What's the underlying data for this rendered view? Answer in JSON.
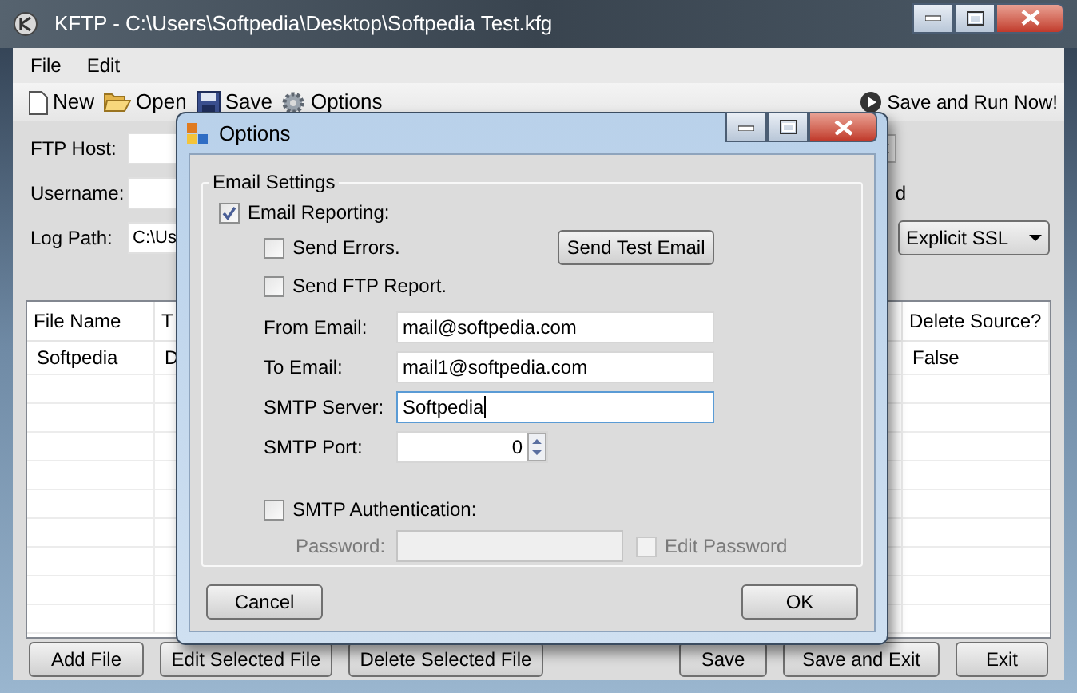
{
  "window": {
    "title": "KFTP - C:\\Users\\Softpedia\\Desktop\\Softpedia Test.kfg"
  },
  "menu": [
    {
      "label": "File"
    },
    {
      "label": "Edit"
    }
  ],
  "toolbar": {
    "items": [
      {
        "label": "New",
        "kind": "new"
      },
      {
        "label": "Open",
        "kind": "open"
      },
      {
        "label": "Save",
        "kind": "save"
      },
      {
        "label": "Options",
        "kind": "options"
      }
    ],
    "run_button": "Save and Run Now!"
  },
  "form": {
    "fields": [
      {
        "label": "FTP Host:"
      },
      {
        "label": "Username:"
      },
      {
        "label": "Log Path:",
        "value": "C:\\Us"
      }
    ],
    "partial_label": "d",
    "encryption": "Explicit SSL"
  },
  "table": {
    "columns": [
      "File Name",
      "T",
      "Delete Source?"
    ],
    "rows": [
      [
        "Softpedia",
        "D",
        "False"
      ]
    ]
  },
  "buttons_left": [
    "Add File",
    "Edit Selected File",
    "Delete Selected File"
  ],
  "buttons_right": [
    "Save",
    "Save and Exit",
    "Exit"
  ],
  "dialog": {
    "title": "Options",
    "group": "Email Settings",
    "email_reporting": {
      "label": "Email Reporting:",
      "checked": true
    },
    "options": [
      {
        "label": "Send Errors.",
        "checked": false
      },
      {
        "label": "Send FTP Report.",
        "checked": false
      }
    ],
    "test_button": "Send Test Email",
    "fields": [
      {
        "label": "From Email:",
        "value": "mail@softpedia.com",
        "focused": false
      },
      {
        "label": "To Email:",
        "value": "mail1@softpedia.com",
        "focused": false
      },
      {
        "label": "SMTP Server:",
        "value": "Softpedia",
        "focused": true
      }
    ],
    "port": {
      "label": "SMTP Port:",
      "value": "0"
    },
    "smtp_auth": {
      "label": "SMTP Authentication:",
      "checked": false
    },
    "password": {
      "label": "Password:",
      "disabled": true
    },
    "edit_password": {
      "label": "Edit Password",
      "checked": false,
      "disabled": true
    },
    "buttons": [
      "Cancel",
      "OK"
    ]
  }
}
